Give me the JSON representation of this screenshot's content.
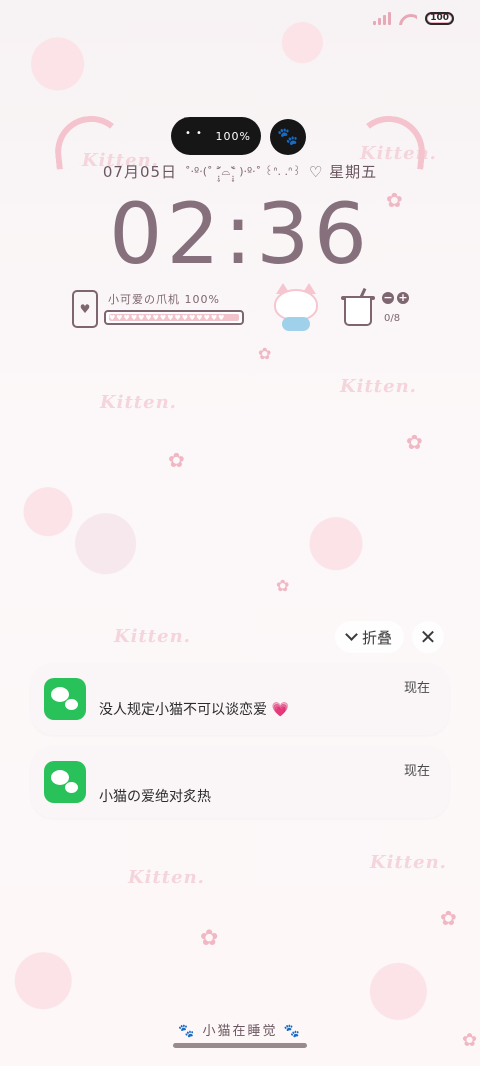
{
  "status_bar": {
    "battery": "100"
  },
  "lock": {
    "pill_percent": "100%",
    "paw_icon": "paw-icon",
    "date": "07月05日",
    "kaomoji": "˚‧º·(˚ ˃̣̣̥᷄⌓˂̣̣̥᷅ )‧º·˚ ꒰ᐢ. .ᐢ꒱",
    "weekday": "♡ 星期五",
    "time": "02:36"
  },
  "widgets": {
    "battery_label": "小可爱の爪机 100%",
    "battery_level": 1.0,
    "water_count": "0/8",
    "minus": "−",
    "plus": "+"
  },
  "notifications": {
    "collapse_label": "折叠",
    "close_icon": "close-icon",
    "items": [
      {
        "app": "wechat",
        "message": "没人规定小猫不可以谈恋爱",
        "emoji": "💗",
        "time": "现在"
      },
      {
        "app": "wechat",
        "message": "小猫の爱绝对炙热",
        "time": "现在"
      }
    ]
  },
  "footer": {
    "sleep_label": "🐾 小猫在睡觉 🐾"
  },
  "colors": {
    "accent_pink": "#f4c3cd",
    "clock": "#86707b",
    "wechat_green": "#29c25a",
    "pill_black": "#161616"
  }
}
